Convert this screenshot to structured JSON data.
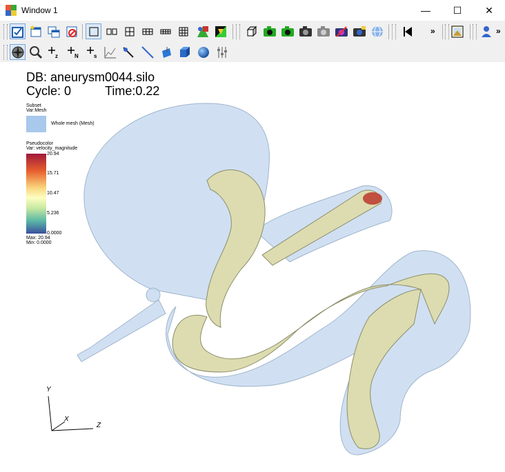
{
  "window": {
    "title": "Window 1",
    "minimize": "—",
    "maximize": "☐",
    "close": "✕"
  },
  "toolbar1": {
    "buttons": [
      "toggle-mode",
      "new-window",
      "clone-window",
      "clear-window",
      "layout-1x1",
      "layout-1x2",
      "layout-2x2",
      "layout-2x3",
      "layout-3x2",
      "layout-3x3",
      "lock-view",
      "lock-time",
      "view-3d",
      "save-image",
      "export",
      "navigate",
      "zoom-settings",
      "camera",
      "camera-lock",
      "print",
      "rewind",
      "play-back"
    ],
    "overflow": "»"
  },
  "toolbar2": {
    "buttons": [
      "navigate-mode",
      "zoom-mode",
      "add-plot-z",
      "add-plot-n",
      "add-plot-s",
      "curve-pick",
      "pick-point",
      "line-out",
      "box-tool",
      "cube",
      "sphere",
      "sliders"
    ]
  },
  "plot": {
    "db_label": "DB: aneurysm0044.silo",
    "cycle_label": "Cycle: 0",
    "time_label": "Time:0.22",
    "subset_title": "Subset",
    "subset_var": "Var:Mesh",
    "subset_entry": "Whole mesh (Mesh)",
    "pseudo_title": "Pseudocolor",
    "pseudo_var": "Var: velocity_magnitude",
    "ticks": [
      "20.94",
      "15.71",
      "10.47",
      "5.236",
      "0.0000"
    ],
    "max_label": "Max: 20.94",
    "min_label": "Min: 0.0000",
    "axis_y": "Y",
    "axis_x": "X",
    "axis_z": "Z"
  },
  "colors": {
    "mesh_fill": "#c8daf0",
    "vessel_fill": "#dcdcb0",
    "legend_swatch": "#a8c8ec"
  }
}
